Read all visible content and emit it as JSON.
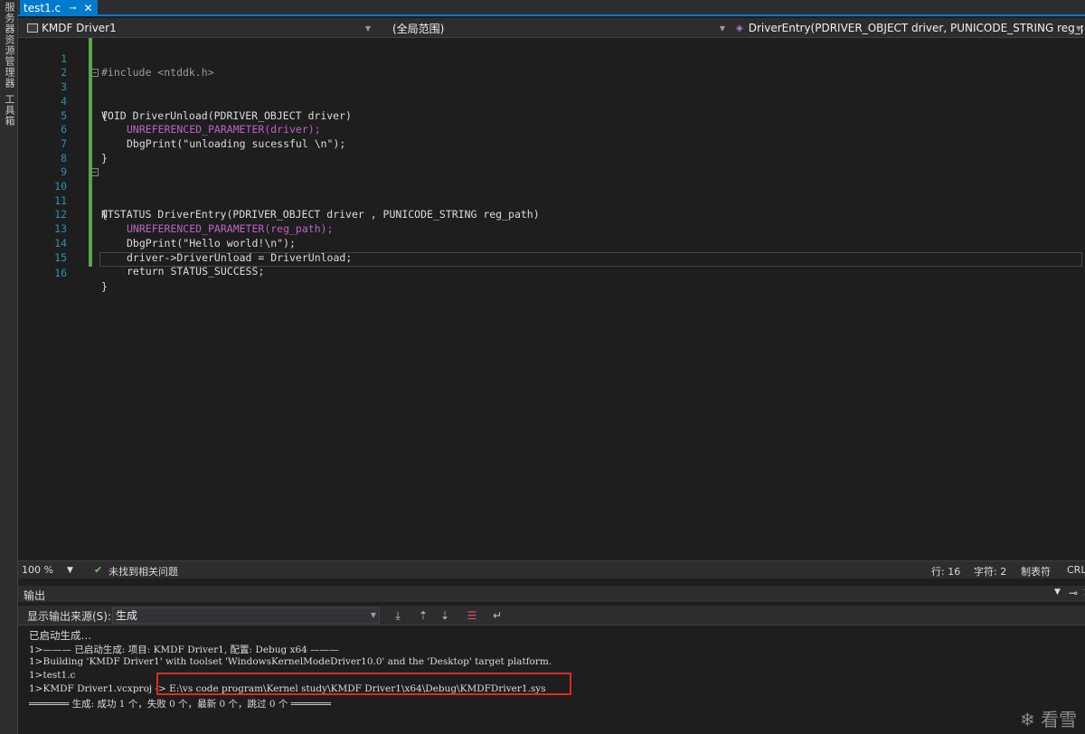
{
  "left_rail": {
    "items": [
      "服务器资源管理器",
      "工具箱"
    ]
  },
  "tab": {
    "label": "test1.c",
    "pin": "⊸",
    "close": "✕"
  },
  "navbar": {
    "project": "KMDF Driver1",
    "scope": "(全局范围)",
    "function": "DriverEntry(PDRIVER_OBJECT driver, PUNICODE_STRING reg_p"
  },
  "code_lines": [
    {
      "n": "1",
      "text": "#include <ntddk.h>"
    },
    {
      "n": "2",
      "text": ""
    },
    {
      "n": "3",
      "text": "VOID DriverUnload(PDRIVER_OBJECT driver)"
    },
    {
      "n": "4",
      "text": "{"
    },
    {
      "n": "5",
      "text": "UNREFERENCED_PARAMETER(driver);"
    },
    {
      "n": "6",
      "text": "DbgPrint(\"unloading sucessful \\n\");"
    },
    {
      "n": "7",
      "text": "}"
    },
    {
      "n": "8",
      "text": ""
    },
    {
      "n": "9",
      "text": ""
    },
    {
      "n": "10",
      "text": "NTSTATUS DriverEntry(PDRIVER_OBJECT driver , PUNICODE_STRING reg_path)"
    },
    {
      "n": "11",
      "text": "{"
    },
    {
      "n": "12",
      "text": "UNREFERENCED_PARAMETER(reg_path);"
    },
    {
      "n": "13",
      "text": "DbgPrint(\"Hello world!\\n\");"
    },
    {
      "n": "14",
      "text": "driver->DriverUnload = DriverUnload;"
    },
    {
      "n": "15",
      "text": "return STATUS_SUCCESS;"
    },
    {
      "n": "16",
      "text": "}"
    }
  ],
  "status": {
    "zoom": "100 %",
    "issues": "未找到相关问题",
    "line": "行: 16",
    "char": "字符: 2",
    "tabs": "制表符",
    "eol": "CRL"
  },
  "output": {
    "title": "输出",
    "source_label": "显示输出来源(S):",
    "source_value": "生成",
    "lines": [
      "已启动生成…",
      "1>——— 已启动生成: 项目: KMDF Driver1, 配置: Debug x64 ———",
      "1>Building 'KMDF Driver1' with toolset 'WindowsKernelModeDriver10.0' and the 'Desktop' target platform.",
      "1>test1.c",
      "1>KMDF Driver1.vcxproj -> E:\\vs code program\\Kernel study\\KMDF Driver1\\x64\\Debug\\KMDFDriver1.sys",
      "═══════ 生成: 成功 1 个，失败 0 个，最新 0 个，跳过 0 个 ═══════"
    ]
  },
  "watermark": "看雪"
}
